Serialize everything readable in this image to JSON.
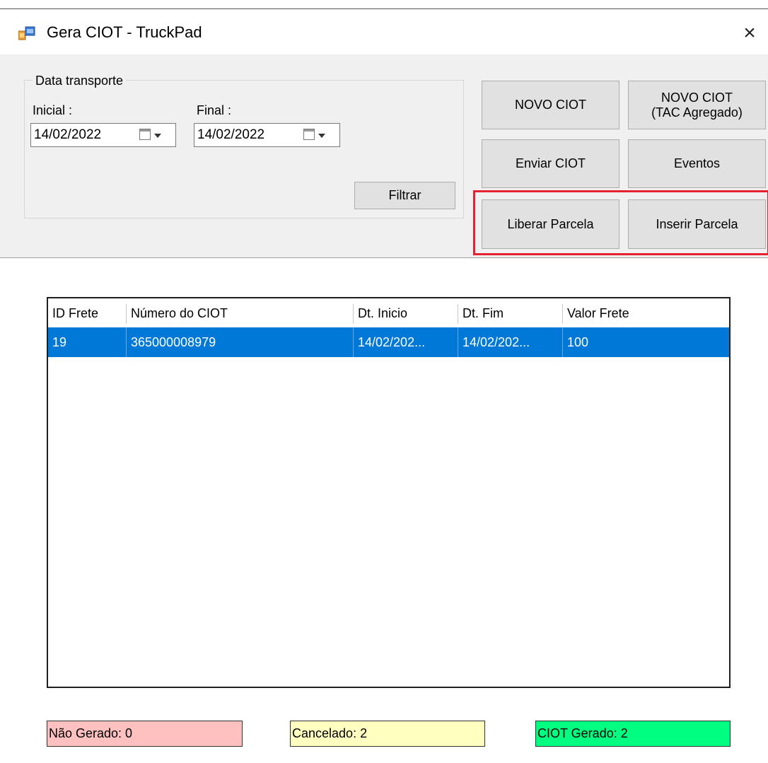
{
  "window": {
    "title": "Gera CIOT - TruckPad",
    "close_glyph": "×",
    "icon": "app-window-icon"
  },
  "filter": {
    "group_title": "Data transporte",
    "initial_label": "Inicial :",
    "initial_value": "14/02/2022",
    "final_label": "Final :",
    "final_value": "14/02/2022",
    "filter_button": "Filtrar"
  },
  "actions": {
    "novo_ciot": "NOVO CIOT",
    "novo_ciot_tac_line1": "NOVO CIOT",
    "novo_ciot_tac_line2": "(TAC Agregado)",
    "enviar_ciot": "Enviar CIOT",
    "eventos": "Eventos",
    "liberar_parcela": "Liberar Parcela",
    "inserir_parcela": "Inserir Parcela"
  },
  "table": {
    "columns": [
      "ID Frete",
      "Número do CIOT",
      "Dt. Inicio",
      "Dt. Fim",
      "Valor Frete"
    ],
    "rows": [
      [
        "19",
        "365000008979",
        "14/02/202...",
        "14/02/202...",
        "100"
      ]
    ]
  },
  "status": {
    "nao_gerado": "Não Gerado: 0",
    "cancelado": "Cancelado: 2",
    "ciot_gerado": "CIOT Gerado: 2"
  },
  "colors": {
    "selection": "#0078d7",
    "highlight_border": "#e52132",
    "nao_gerado_bg": "#ffc0c0",
    "cancelado_bg": "#ffffc0",
    "ciot_gerado_bg": "#00ff80"
  }
}
